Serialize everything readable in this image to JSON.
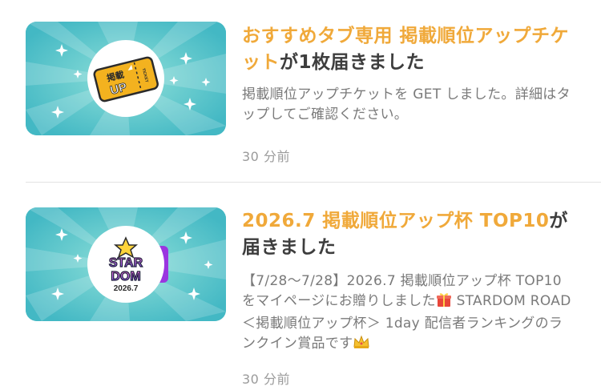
{
  "notifications": [
    {
      "title_highlight": "おすすめタブ専用 掲載順位アップチケット",
      "title_rest": "が1枚届きました",
      "body": "掲載順位アップチケットを GET しました。詳細はタップしてご確認ください。",
      "time": "30 分前",
      "thumbnail": {
        "icon": "ticket-icon",
        "label_top": "掲載",
        "label_main": "UP",
        "label_side": "TICKET"
      }
    },
    {
      "title_highlight": "2026.7 掲載順位アップ杯 TOP10",
      "title_rest": "が届きました",
      "body_parts": [
        "【7/28～7/28】2026.7 掲載順位アップ杯 TOP10 をマイページにお贈りしました",
        " STARDOM ROAD ＜掲載順位アップ杯＞ 1day 配信者ランキングのランクイン賞品です"
      ],
      "time": "30 分前",
      "thumbnail": {
        "icon": "stardom-badge-icon",
        "line1": "STAR",
        "line2": "DOM",
        "line3": "2026.7"
      }
    }
  ],
  "colors": {
    "highlight": "#f0a93a",
    "thumb_bg": "#57c6c6"
  }
}
